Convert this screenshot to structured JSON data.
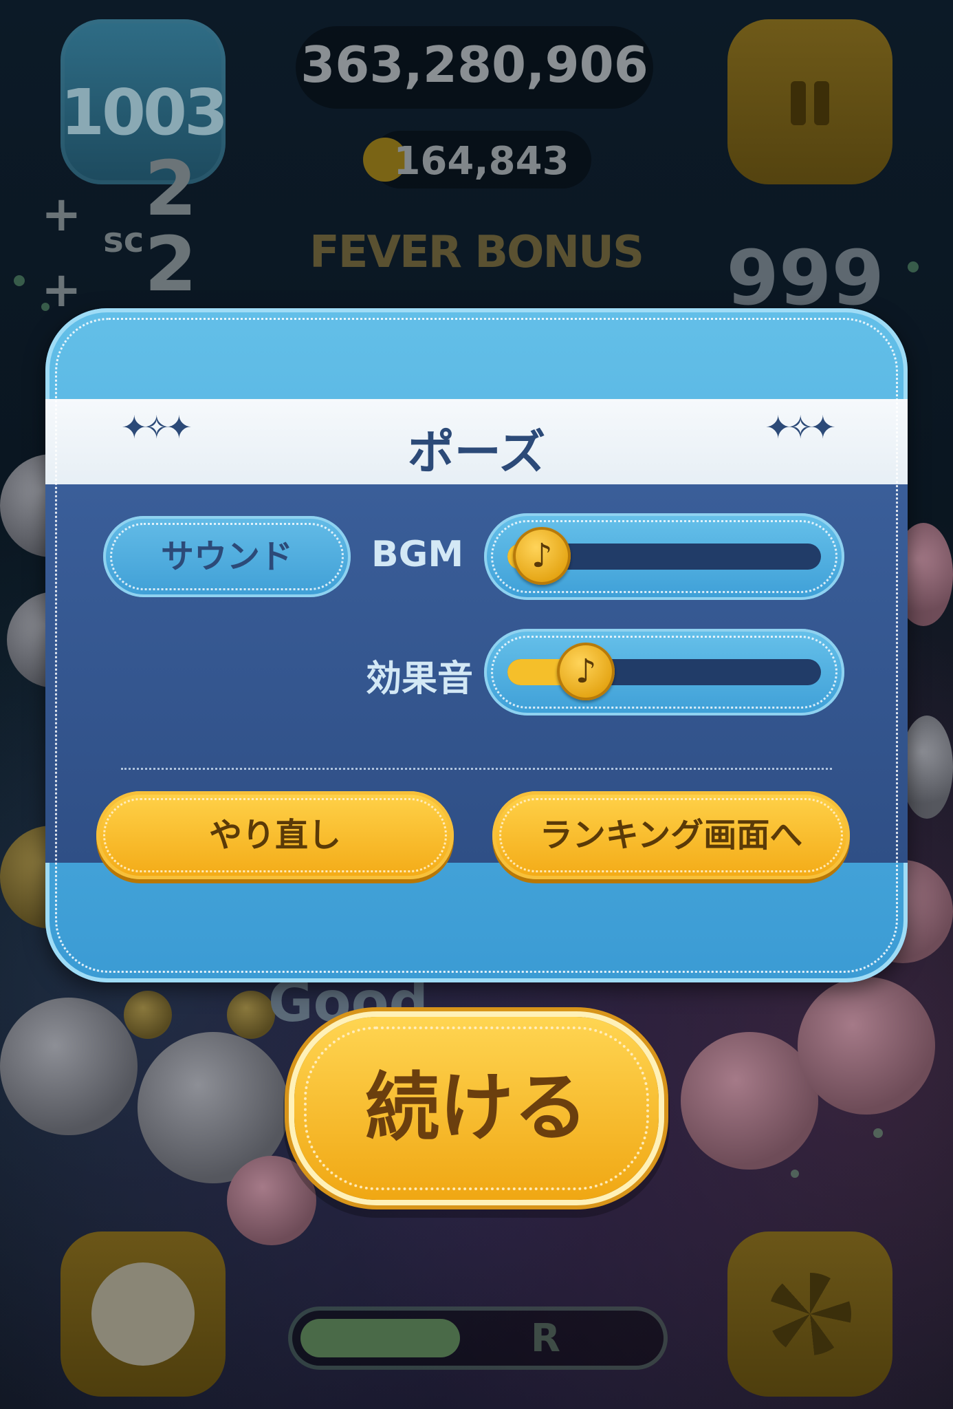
{
  "hud": {
    "level": "1003",
    "score": "363,280,906",
    "coins": "164,843",
    "combo_plus_1": "+",
    "combo_value_1": "2",
    "combo_plus_2": "+",
    "combo_value_2": "2",
    "combo_prefix": "sc",
    "fever_bonus": "FEVER BONUS",
    "timer": "999",
    "good": "Good",
    "fever_gauge_label": "R",
    "fever_gauge_level": 0.45
  },
  "dialog": {
    "title": "ポーズ",
    "sparkles_left": "✦✧✦",
    "sparkles_right": "✦✧✦",
    "sound_label": "サウンド",
    "bgm_label": "BGM",
    "bgm_level": 0.04,
    "bgm_knob_icon": "music-note-icon",
    "bgm_knob_glyph": "♪",
    "sfx_label": "効果音",
    "sfx_level": 0.18,
    "sfx_knob_glyph": "♪",
    "retry_label": "やり直し",
    "ranking_label": "ランキング画面へ",
    "continue_label": "続ける"
  },
  "colors": {
    "dialog_blue": "#4fb0e0",
    "panel_navy": "#34568f",
    "button_orange": "#f7b928",
    "title_text": "#2c4a78"
  }
}
